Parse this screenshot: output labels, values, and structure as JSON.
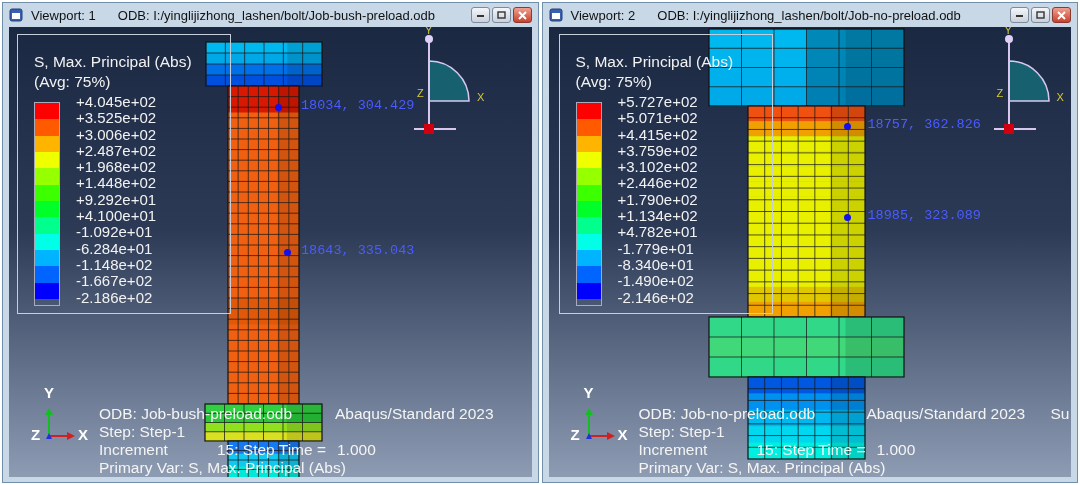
{
  "viewports": [
    {
      "title": "Viewport: 1",
      "odb_path": "ODB: I:/yinglijizhong_lashen/bolt/Job-bush-preload.odb",
      "legend": {
        "title": "S, Max. Principal (Abs)",
        "averaging": "(Avg: 75%)",
        "bands": [
          {
            "color": "#ff0000"
          },
          {
            "color": "#ff5a00"
          },
          {
            "color": "#ffb400"
          },
          {
            "color": "#f0ff00"
          },
          {
            "color": "#96ff00"
          },
          {
            "color": "#3cff00"
          },
          {
            "color": "#00ff28"
          },
          {
            "color": "#00ff8c"
          },
          {
            "color": "#00ffe6"
          },
          {
            "color": "#00b4ff"
          },
          {
            "color": "#0064ff"
          },
          {
            "color": "#0000ff"
          }
        ],
        "ticks": [
          "+4.045e+02",
          "+3.525e+02",
          "+3.006e+02",
          "+2.487e+02",
          "+1.968e+02",
          "+1.448e+02",
          "+9.292e+01",
          "+4.100e+01",
          "-1.092e+01",
          "-6.284e+01",
          "-1.148e+02",
          "-1.667e+02",
          "-2.186e+02"
        ]
      },
      "probes": [
        {
          "label": "18034, 304.429"
        },
        {
          "label": "18643, 335.043"
        }
      ],
      "top_triad": {
        "y": "Y",
        "z": "Z",
        "x": "X"
      },
      "bottom_triad": {
        "y": "Y",
        "z": "Z",
        "x": "X"
      },
      "info": {
        "odb": "ODB: Job-bush-preload.odb",
        "solver": "Abaqus/Standard 2023",
        "step": "Step: Step-1",
        "increment": "Increment",
        "increment_value": "15: Step Time =",
        "step_time": "1.000",
        "primary_var": "Primary Var: S, Max. Principal (Abs)"
      }
    },
    {
      "title": "Viewport: 2",
      "odb_path": "ODB: I:/yinglijizhong_lashen/bolt/Job-no-preload.odb",
      "legend": {
        "title": "S, Max. Principal (Abs)",
        "averaging": "(Avg: 75%)",
        "bands": [
          {
            "color": "#ff0000"
          },
          {
            "color": "#ff5a00"
          },
          {
            "color": "#ffb400"
          },
          {
            "color": "#f0ff00"
          },
          {
            "color": "#96ff00"
          },
          {
            "color": "#3cff00"
          },
          {
            "color": "#00ff28"
          },
          {
            "color": "#00ff8c"
          },
          {
            "color": "#00ffe6"
          },
          {
            "color": "#00b4ff"
          },
          {
            "color": "#0064ff"
          },
          {
            "color": "#0000ff"
          }
        ],
        "ticks": [
          "+5.727e+02",
          "+5.071e+02",
          "+4.415e+02",
          "+3.759e+02",
          "+3.102e+02",
          "+2.446e+02",
          "+1.790e+02",
          "+1.134e+02",
          "+4.782e+01",
          "-1.779e+01",
          "-8.340e+01",
          "-1.490e+02",
          "-2.146e+02"
        ]
      },
      "probes": [
        {
          "label": "18757, 362.826"
        },
        {
          "label": "18985, 323.089"
        }
      ],
      "top_triad": {
        "y": "Y",
        "z": "Z",
        "x": "X"
      },
      "bottom_triad": {
        "y": "Y",
        "z": "Z",
        "x": "X"
      },
      "info": {
        "odb": "ODB: Job-no-preload.odb",
        "solver": "Abaqus/Standard 2023",
        "step": "Step: Step-1",
        "increment": "Increment",
        "increment_value": "15: Step Time =",
        "step_time": "1.000",
        "primary_var": "Primary Var: S, Max. Principal (Abs)",
        "cut_text": "Su"
      }
    }
  ]
}
